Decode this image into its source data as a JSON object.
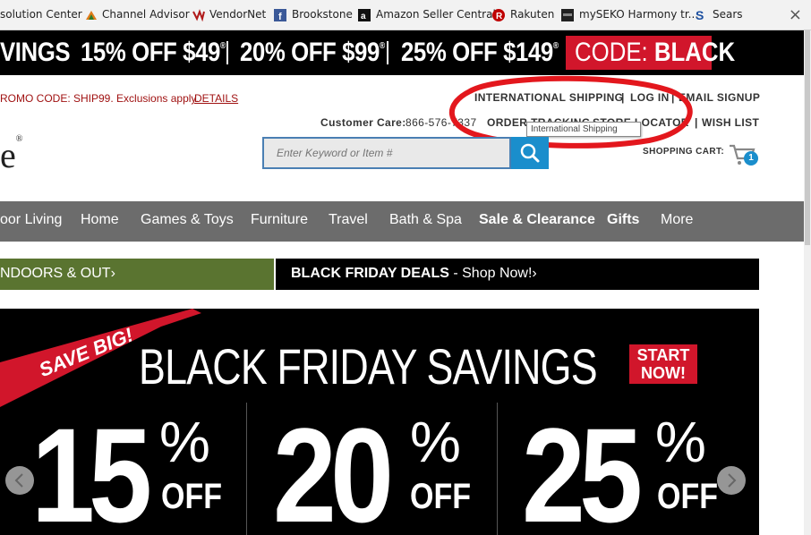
{
  "bookmarks": [
    {
      "label": "solution Center",
      "icon": "none"
    },
    {
      "label": "Channel Advisor",
      "icon": "channel-advisor-icon"
    },
    {
      "label": "VendorNet",
      "icon": "vendornet-icon"
    },
    {
      "label": "Brookstone",
      "icon": "facebook-icon"
    },
    {
      "label": "Amazon Seller Central",
      "icon": "amazon-icon"
    },
    {
      "label": "Rakuten",
      "icon": "rakuten-icon"
    },
    {
      "label": "mySEKO Harmony tr...",
      "icon": "myseko-icon"
    },
    {
      "label": "Sears",
      "icon": "sears-icon"
    }
  ],
  "promo": {
    "part1": "VINGS",
    "part2": "15% OFF $49",
    "part3": "20% OFF $99",
    "part4": "25% OFF $149",
    "code_prefix": "CODE:",
    "code_value": "BLACK"
  },
  "shipping_promo": {
    "text": "ROMO CODE: SHIP99. Exclusions apply.",
    "link": "DETAILS"
  },
  "util_links": {
    "international": "INTERNATIONAL SHIPPING",
    "login": "LOG IN",
    "email": "EMAIL SIGNUP",
    "order": "ORDER TRACKING",
    "store": "STORE LOCATOR",
    "wishlist": "WISH LIST",
    "tooltip": "International Shipping"
  },
  "customer_care": {
    "label": "Customer Care:",
    "phone": "866-576-7337"
  },
  "logo_fragment": "e",
  "search": {
    "placeholder": "Enter Keyword or Item #"
  },
  "cart": {
    "label": "SHOPPING CART:",
    "count": "1"
  },
  "nav": [
    "oor Living",
    "Home",
    "Games & Toys",
    "Furniture",
    "Travel",
    "Bath & Spa",
    "Sale & Clearance",
    "Gifts",
    "More"
  ],
  "ribbon": {
    "green_text": "NDOORS & OUT",
    "black_bold": "BLACK FRIDAY DEALS",
    "black_rest": " - Shop Now!"
  },
  "hero": {
    "save_big": "SAVE BIG!",
    "headline": "BLACK FRIDAY SAVINGS",
    "start_now": [
      "START",
      "NOW!"
    ],
    "offers": [
      {
        "num": "15",
        "pct": "%",
        "off": "OFF"
      },
      {
        "num": "20",
        "pct": "%",
        "off": "OFF"
      },
      {
        "num": "25",
        "pct": "%",
        "off": "OFF"
      }
    ]
  },
  "colors": {
    "accent_red": "#d1162b",
    "nav_gray": "#6c6c6c",
    "green": "#5a7430",
    "search_blue": "#1a8ecc",
    "annotation_red": "#e3171d"
  }
}
